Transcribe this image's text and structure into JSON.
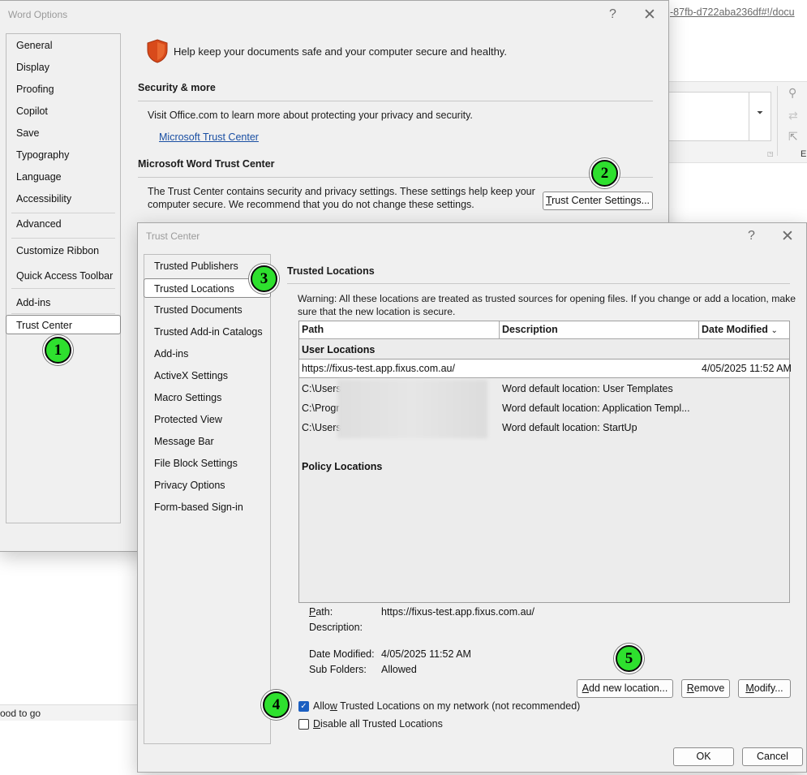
{
  "background_window": {
    "url_fragment": "-87fb-d722aba236df#!/docu",
    "status_text": "ood to go",
    "ribbon_letter": "E"
  },
  "word_options": {
    "title": "Word Options",
    "help": "?",
    "close": "✕",
    "nav": [
      {
        "label": "General"
      },
      {
        "label": "Display"
      },
      {
        "label": "Proofing"
      },
      {
        "label": "Copilot"
      },
      {
        "label": "Save"
      },
      {
        "label": "Typography"
      },
      {
        "label": "Language"
      },
      {
        "label": "Accessibility"
      },
      {
        "label": "Advanced"
      },
      {
        "label": "Customize Ribbon"
      },
      {
        "label": "Quick Access Toolbar"
      },
      {
        "label": "Add-ins"
      },
      {
        "label": "Trust Center",
        "selected": true
      }
    ],
    "header_text": "Help keep your documents safe and your computer secure and healthy.",
    "security_section": {
      "title": "Security & more",
      "text": "Visit Office.com to learn more about protecting your privacy and security.",
      "link": "Microsoft Trust Center"
    },
    "trust_center_section": {
      "title": "Microsoft Word Trust Center",
      "text_line1": "The Trust Center contains security and privacy settings. These settings help keep your",
      "text_line2": "computer secure. We recommend that you do not change these settings.",
      "button_prefix": "",
      "button_ul": "T",
      "button_rest": "rust Center Settings..."
    }
  },
  "trust_center": {
    "title": "Trust Center",
    "help": "?",
    "close": "✕",
    "nav": [
      {
        "label": "Trusted Publishers"
      },
      {
        "label": "Trusted Locations",
        "selected": true
      },
      {
        "label": "Trusted Documents"
      },
      {
        "label": "Trusted Add-in Catalogs"
      },
      {
        "label": "Add-ins"
      },
      {
        "label": "ActiveX Settings"
      },
      {
        "label": "Macro Settings"
      },
      {
        "label": "Protected View"
      },
      {
        "label": "Message Bar"
      },
      {
        "label": "File Block Settings"
      },
      {
        "label": "Privacy Options"
      },
      {
        "label": "Form-based Sign-in"
      }
    ],
    "section_title": "Trusted Locations",
    "warning_line1": "Warning: All these locations are treated as trusted sources for opening files.  If you change or add a location, make",
    "warning_line2": "sure that the new location is secure.",
    "table": {
      "columns": [
        "Path",
        "Description",
        "Date Modified"
      ],
      "sort_indicator": "⌄",
      "user_group": "User Locations",
      "rows": [
        {
          "path": "https://fixus-test.app.fixus.com.au/",
          "description": "",
          "date": "4/05/2025 11:52 AM",
          "selected": true
        },
        {
          "path": "C:\\Users",
          "description": "Word default location: User Templates",
          "date": ""
        },
        {
          "path": "C:\\Progr",
          "description": "Word default location: Application Templ...",
          "date": ""
        },
        {
          "path": "C:\\Users",
          "description": "Word default location: StartUp",
          "date": ""
        }
      ],
      "policy_group": "Policy Locations"
    },
    "details": {
      "path_label_ul": "P",
      "path_label_rest": "ath:",
      "path_value": "https://fixus-test.app.fixus.com.au/",
      "description_label": "Description:",
      "description_value": "",
      "date_label": "Date Modified:",
      "date_value": "4/05/2025 11:52 AM",
      "subfolders_label": "Sub Folders:",
      "subfolders_value": "Allowed"
    },
    "buttons": {
      "add_ul": "A",
      "add_rest": "dd new location...",
      "remove_ul": "R",
      "remove_rest": "emove",
      "modify_ul": "M",
      "modify_rest": "odify...",
      "ok": "OK",
      "cancel": "Cancel"
    },
    "allow_network": {
      "pre": "Allo",
      "ul": "w",
      "post": " Trusted Locations on my network (not recommended)",
      "checked": true
    },
    "disable_all": {
      "pre": "",
      "ul": "D",
      "post": "isable all Trusted Locations",
      "checked": false
    }
  },
  "markers": [
    "1",
    "2",
    "3",
    "4",
    "5"
  ],
  "colors": {
    "dialog_bg": "#f0f0f0",
    "shield": "#d84a1b",
    "link": "#1a4fa3",
    "marker": "#2ee02e",
    "checkbox_on": "#1b5fc1"
  }
}
